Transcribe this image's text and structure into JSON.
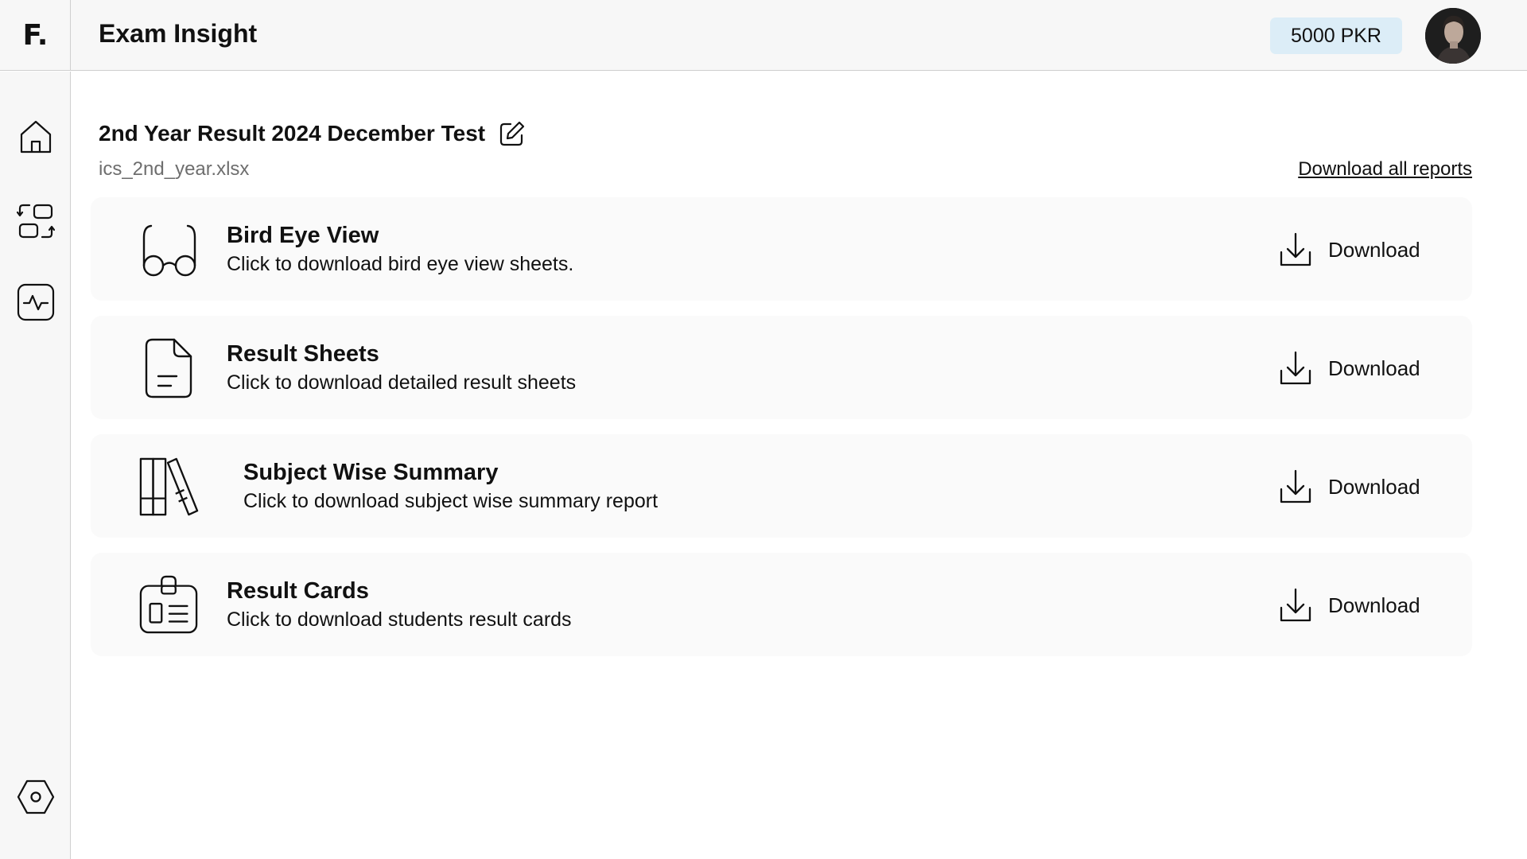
{
  "app": {
    "logo": "F.",
    "title": "Exam Insight",
    "balance": "5000 PKR"
  },
  "sidebar": {
    "items": [
      {
        "icon": "home-icon"
      },
      {
        "icon": "switch-layout-icon"
      },
      {
        "icon": "activity-icon"
      }
    ],
    "bottom_icon": "settings-icon"
  },
  "page": {
    "title": "2nd Year Result 2024 December Test",
    "file_name": "ics_2nd_year.xlsx",
    "download_all": "Download all reports"
  },
  "reports": [
    {
      "icon": "glasses-icon",
      "title": "Bird Eye View",
      "description": "Click to download bird eye view sheets.",
      "action": "Download"
    },
    {
      "icon": "document-icon",
      "title": "Result Sheets",
      "description": "Click to download detailed result sheets",
      "action": "Download"
    },
    {
      "icon": "books-icon",
      "title": "Subject Wise Summary",
      "description": "Click to download subject wise summary report",
      "action": "Download"
    },
    {
      "icon": "id-card-icon",
      "title": "Result Cards",
      "description": "Click to download students result cards",
      "action": "Download"
    }
  ],
  "colors": {
    "topbar_bg": "#f7f7f7",
    "balance_bg": "#dcedf7",
    "card_bg": "#fafafa",
    "muted_text": "#6e6e6e"
  }
}
